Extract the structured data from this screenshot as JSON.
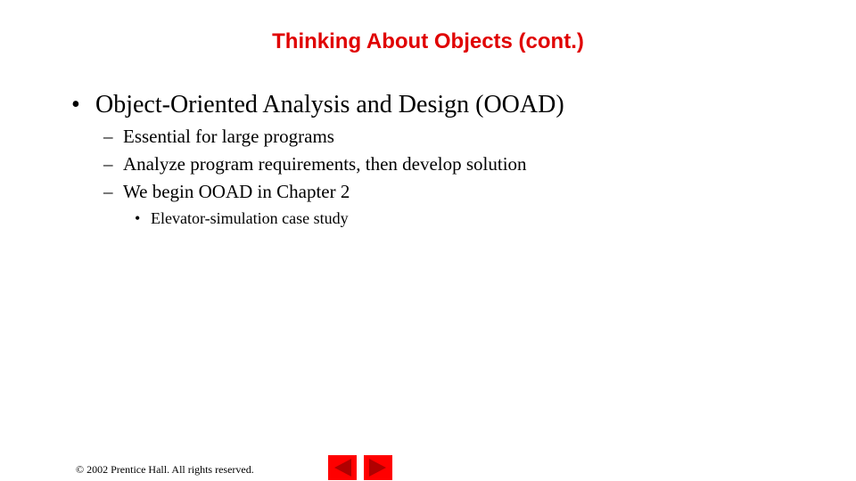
{
  "slide": {
    "title": "Thinking About Objects (cont.)",
    "bullets": {
      "level1_marker": "•",
      "level2_marker": "–",
      "level3_marker": "•",
      "main": "Object-Oriented Analysis and Design (OOAD)",
      "sub": [
        "Essential for large programs",
        "Analyze program requirements, then develop solution",
        "We begin OOAD in Chapter 2"
      ],
      "subsub": [
        "Elevator-simulation case study"
      ]
    }
  },
  "footer": {
    "copyright": "© 2002 Prentice Hall.  All rights reserved."
  },
  "navigation": {
    "prev_icon": "left-triangle",
    "next_icon": "right-triangle",
    "button_color": "#ff0000",
    "arrow_color": "#b00000"
  }
}
